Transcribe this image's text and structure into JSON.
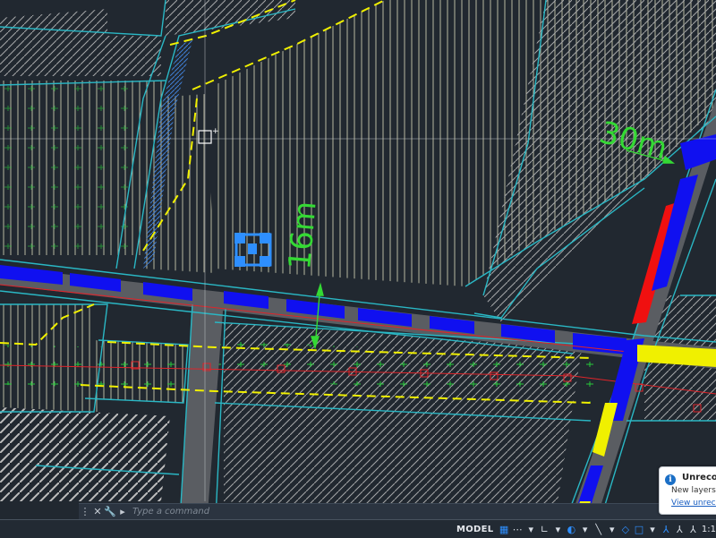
{
  "canvas": {
    "dimensions": [
      "30m",
      "16m"
    ],
    "colors": {
      "background": "#212830",
      "road": "#5a5d62",
      "cyan_edge": "#2ab7c4",
      "blue_lane": "#1010f0",
      "red_lane": "#f01010",
      "yellow_lane": "#f0f000",
      "dim_green": "#34d934"
    }
  },
  "command_line": {
    "placeholder": "Type a command",
    "close_icon": "✕",
    "settings_icon": "wrench-icon"
  },
  "status_bar": {
    "model_tab": "MODEL",
    "scale": "1:1"
  },
  "notification": {
    "title": "Unreconc",
    "body": "New layers w",
    "link": "View unrecon"
  }
}
